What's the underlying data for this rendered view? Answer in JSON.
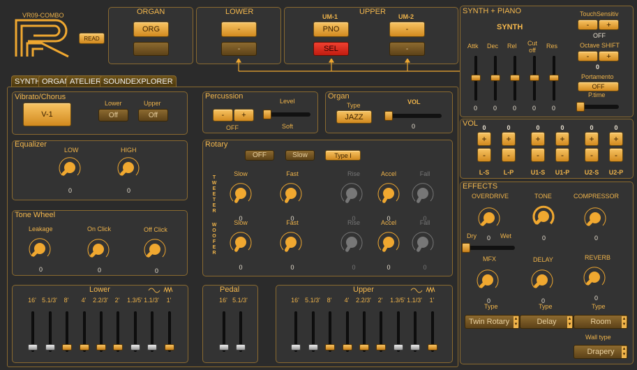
{
  "logo": {
    "title": "VR09-COMBO",
    "read": "READ"
  },
  "organ_top": {
    "title": "ORGAN",
    "btn": "ORG"
  },
  "lower_top": {
    "title": "LOWER",
    "btn": "-"
  },
  "upper_top": {
    "title": "UPPER",
    "um1": "UM-1",
    "um2": "UM-2",
    "pno": "PNO",
    "sel": "SEL",
    "dash": "-"
  },
  "synthpiano": {
    "title": "SYNTH + PIANO",
    "touch": "TouchSensitiv",
    "minus": "-",
    "plus": "+",
    "off": "OFF",
    "synth": "SYNTH",
    "attk": "Attk",
    "dec": "Dec",
    "rel": "Rel",
    "cutoff": "Cut\noff",
    "res": "Res",
    "octave": "Octave SHIFT",
    "octval": "0",
    "porta": "Portamento",
    "porta_off": "OFF",
    "ptime": "P.time",
    "vals": [
      "0",
      "0",
      "0",
      "0",
      "0"
    ]
  },
  "tabs": [
    "SYNTH",
    "ORGAN",
    "ATELIER",
    "SOUNDEXPLORER"
  ],
  "vibrato": {
    "title": "Vibrato/Chorus",
    "v1": "V-1",
    "lower": "Lower",
    "upper": "Upper",
    "off": "Off"
  },
  "percussion": {
    "title": "Percussion",
    "level": "Level",
    "minus": "-",
    "plus": "+",
    "off": "OFF",
    "soft": "Soft"
  },
  "organ": {
    "title": "Organ",
    "type": "Type",
    "vol": "VOL",
    "jazz": "JAZZ",
    "volval": "0"
  },
  "equalizer": {
    "title": "Equalizer",
    "low": "LOW",
    "high": "HIGH",
    "lowval": "0",
    "highval": "0"
  },
  "rotary": {
    "title": "Rotary",
    "off": "OFF",
    "slow": "Slow",
    "type": "Type  I",
    "tweeter": "TWEETER",
    "woofer": "WOOFER",
    "labels": [
      "Slow",
      "Fast",
      "Rise",
      "Accel",
      "Fall"
    ],
    "zero": "0"
  },
  "tonewheel": {
    "title": "Tone Wheel",
    "leakage": "Leakage",
    "onclick": "On Click",
    "offclick": "Off Click",
    "zero": "0"
  },
  "lower_dw": {
    "title": "Lower",
    "labels": [
      "16'",
      "5.1/3'",
      "8'",
      "4'",
      "2.2/3'",
      "2'",
      "1.3/5'",
      "1.1/3'",
      "1'"
    ]
  },
  "pedal": {
    "title": "Pedal",
    "labels": [
      "16'",
      "5.1/3'"
    ]
  },
  "upper_dw": {
    "title": "Upper",
    "labels": [
      "16'",
      "5.1/3'",
      "8'",
      "4'",
      "2.2/3'",
      "2'",
      "1.3/5'",
      "1.1/3'",
      "1'"
    ]
  },
  "vol": {
    "title": "VOL",
    "zero": "0",
    "plus": "+",
    "minus": "-",
    "labels": [
      "L-S",
      "L-P",
      "U1-S",
      "U1-P",
      "U2-S",
      "U2-P"
    ]
  },
  "effects": {
    "title": "EFFECTS",
    "overdrive": "OVERDRIVE",
    "tone": "TONE",
    "compressor": "COMPRESSOR",
    "dry": "Dry",
    "wet": "Wet",
    "zero": "0",
    "mfx": "MFX",
    "delay": "DELAY",
    "reverb": "REVERB",
    "type": "Type",
    "mfxsel": "Twin Rotary",
    "delaysel": "Delay",
    "reverbsel": "Room",
    "walltype": "Wall type",
    "wallsel": "Drapery"
  }
}
